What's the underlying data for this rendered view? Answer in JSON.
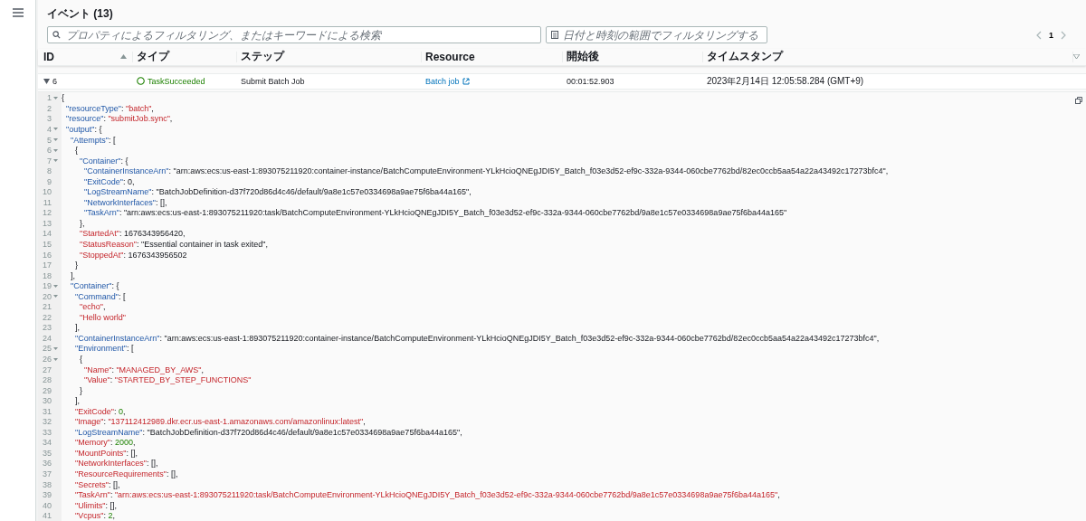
{
  "header": {
    "title": "イベント (13)"
  },
  "search": {
    "placeholder": "プロパティによるフィルタリング、またはキーワードによる検索"
  },
  "date_filter": {
    "placeholder": "日付と時刻の範囲でフィルタリングする"
  },
  "pagination": {
    "page": "1"
  },
  "table": {
    "columns": [
      {
        "label": "ID",
        "sorted": true
      },
      {
        "label": "タイプ",
        "sorted": false
      },
      {
        "label": "ステップ",
        "sorted": false
      },
      {
        "label": "Resource",
        "sorted": false
      },
      {
        "label": "開始後",
        "sorted": false
      },
      {
        "label": "タイムスタンプ",
        "sorted": false
      }
    ],
    "rows": [
      {
        "id": "6",
        "expanded": true,
        "type": "TaskSucceeded",
        "kind": "succeeded",
        "step": "Submit Batch Job",
        "resource": "Batch job",
        "elapsed": "00:01:52.903",
        "timestamp": "2023年2月14日 12:05:58.284 (GMT+9)"
      }
    ]
  },
  "code": {
    "lines": [
      {
        "number": "1",
        "fold": true,
        "tokens": [
          {
            "text": "{",
            "kind": "plain"
          }
        ]
      },
      {
        "number": "2",
        "fold": false,
        "tokens": [
          {
            "text": "  \"resourceType\"",
            "kind": "key"
          },
          {
            "text": ": ",
            "kind": "plain"
          },
          {
            "text": "\"batch\"",
            "kind": "string"
          },
          {
            "text": ",",
            "kind": "plain"
          }
        ]
      },
      {
        "number": "3",
        "fold": false,
        "tokens": [
          {
            "text": "  \"resource\"",
            "kind": "key"
          },
          {
            "text": ": ",
            "kind": "plain"
          },
          {
            "text": "\"submitJob.sync\"",
            "kind": "string"
          },
          {
            "text": ",",
            "kind": "plain"
          }
        ]
      },
      {
        "number": "4",
        "fold": true,
        "tokens": [
          {
            "text": "  \"output\"",
            "kind": "key"
          },
          {
            "text": ": {",
            "kind": "plain"
          }
        ]
      },
      {
        "number": "5",
        "fold": true,
        "tokens": [
          {
            "text": "    \"Attempts\"",
            "kind": "key"
          },
          {
            "text": ": [",
            "kind": "plain"
          }
        ]
      },
      {
        "number": "6",
        "fold": true,
        "tokens": [
          {
            "text": "      {",
            "kind": "plain"
          }
        ]
      },
      {
        "number": "7",
        "fold": true,
        "tokens": [
          {
            "text": "        \"Container\"",
            "kind": "key"
          },
          {
            "text": ": {",
            "kind": "plain"
          }
        ]
      },
      {
        "number": "8",
        "fold": false,
        "tokens": [
          {
            "text": "          \"ContainerInstanceArn\"",
            "kind": "key"
          },
          {
            "text": ": \"arn:aws:ecs:us-east-1:893075211920:container-instance/BatchComputeEnvironment-YLkHcioQNEgJDI5Y_Batch_f03e3d52-ef9c-332a-9344-060cbe7762bd/82ec0ccb5aa54a22a43492c17273bfc4\",",
            "kind": "plain"
          }
        ]
      },
      {
        "number": "9",
        "fold": false,
        "tokens": [
          {
            "text": "          \"ExitCode\"",
            "kind": "key"
          },
          {
            "text": ": 0,",
            "kind": "plain"
          }
        ]
      },
      {
        "number": "10",
        "fold": false,
        "tokens": [
          {
            "text": "          \"LogStreamName\"",
            "kind": "key"
          },
          {
            "text": ": \"BatchJobDefinition-d37f720d86d4c46/default/9a8e1c57e0334698a9ae75f6ba44a165\",",
            "kind": "plain"
          }
        ]
      },
      {
        "number": "11",
        "fold": false,
        "tokens": [
          {
            "text": "          \"NetworkInterfaces\"",
            "kind": "key"
          },
          {
            "text": ": [],",
            "kind": "plain"
          }
        ]
      },
      {
        "number": "12",
        "fold": false,
        "tokens": [
          {
            "text": "          \"TaskArn\"",
            "kind": "key"
          },
          {
            "text": ": \"arn:aws:ecs:us-east-1:893075211920:task/BatchComputeEnvironment-YLkHcioQNEgJDI5Y_Batch_f03e3d52-ef9c-332a-9344-060cbe7762bd/9a8e1c57e0334698a9ae75f6ba44a165\"",
            "kind": "plain"
          }
        ]
      },
      {
        "number": "13",
        "fold": false,
        "tokens": [
          {
            "text": "        },",
            "kind": "plain"
          }
        ]
      },
      {
        "number": "14",
        "fold": false,
        "tokens": [
          {
            "text": "        \"StartedAt\"",
            "kind": "string"
          },
          {
            "text": ": 1676343956420,",
            "kind": "plain"
          }
        ]
      },
      {
        "number": "15",
        "fold": false,
        "tokens": [
          {
            "text": "        \"StatusReason\"",
            "kind": "string"
          },
          {
            "text": ": \"Essential container in task exited\",",
            "kind": "plain"
          }
        ]
      },
      {
        "number": "16",
        "fold": false,
        "tokens": [
          {
            "text": "        \"StoppedAt\"",
            "kind": "string"
          },
          {
            "text": ": 1676343956502",
            "kind": "plain"
          }
        ]
      },
      {
        "number": "17",
        "fold": false,
        "tokens": [
          {
            "text": "      }",
            "kind": "plain"
          }
        ]
      },
      {
        "number": "18",
        "fold": false,
        "tokens": [
          {
            "text": "    ],",
            "kind": "plain"
          }
        ]
      },
      {
        "number": "19",
        "fold": true,
        "tokens": [
          {
            "text": "    \"Container\"",
            "kind": "key"
          },
          {
            "text": ": {",
            "kind": "plain"
          }
        ]
      },
      {
        "number": "20",
        "fold": true,
        "tokens": [
          {
            "text": "      \"Command\"",
            "kind": "key"
          },
          {
            "text": ": [",
            "kind": "plain"
          }
        ]
      },
      {
        "number": "21",
        "fold": false,
        "tokens": [
          {
            "text": "        \"echo\"",
            "kind": "string"
          },
          {
            "text": ",",
            "kind": "plain"
          }
        ]
      },
      {
        "number": "22",
        "fold": false,
        "tokens": [
          {
            "text": "        \"Hello world\"",
            "kind": "string"
          }
        ]
      },
      {
        "number": "23",
        "fold": false,
        "tokens": [
          {
            "text": "      ],",
            "kind": "plain"
          }
        ]
      },
      {
        "number": "24",
        "fold": false,
        "tokens": [
          {
            "text": "      \"ContainerInstanceArn\"",
            "kind": "key"
          },
          {
            "text": ": \"arn:aws:ecs:us-east-1:893075211920:container-instance/BatchComputeEnvironment-YLkHcioQNEgJDI5Y_Batch_f03e3d52-ef9c-332a-9344-060cbe7762bd/82ec0ccb5aa54a22a43492c17273bfc4\",",
            "kind": "plain"
          }
        ]
      },
      {
        "number": "25",
        "fold": true,
        "tokens": [
          {
            "text": "      \"Environment\"",
            "kind": "key"
          },
          {
            "text": ": [",
            "kind": "plain"
          }
        ]
      },
      {
        "number": "26",
        "fold": true,
        "tokens": [
          {
            "text": "        {",
            "kind": "plain"
          }
        ]
      },
      {
        "number": "27",
        "fold": false,
        "tokens": [
          {
            "text": "          \"Name\"",
            "kind": "string"
          },
          {
            "text": ": ",
            "kind": "plain"
          },
          {
            "text": "\"MANAGED_BY_AWS\"",
            "kind": "string"
          },
          {
            "text": ",",
            "kind": "plain"
          }
        ]
      },
      {
        "number": "28",
        "fold": false,
        "tokens": [
          {
            "text": "          \"Value\"",
            "kind": "string"
          },
          {
            "text": ": ",
            "kind": "plain"
          },
          {
            "text": "\"STARTED_BY_STEP_FUNCTIONS\"",
            "kind": "string"
          }
        ]
      },
      {
        "number": "29",
        "fold": false,
        "tokens": [
          {
            "text": "        }",
            "kind": "plain"
          }
        ]
      },
      {
        "number": "30",
        "fold": false,
        "tokens": [
          {
            "text": "      ],",
            "kind": "plain"
          }
        ]
      },
      {
        "number": "31",
        "fold": false,
        "tokens": [
          {
            "text": "      \"ExitCode\"",
            "kind": "string"
          },
          {
            "text": ": ",
            "kind": "plain"
          },
          {
            "text": "0",
            "kind": "number"
          },
          {
            "text": ",",
            "kind": "plain"
          }
        ]
      },
      {
        "number": "32",
        "fold": false,
        "tokens": [
          {
            "text": "      \"Image\"",
            "kind": "string"
          },
          {
            "text": ": ",
            "kind": "plain"
          },
          {
            "text": "\"137112412989.dkr.ecr.us-east-1.amazonaws.com/amazonlinux:latest\"",
            "kind": "string"
          },
          {
            "text": ",",
            "kind": "plain"
          }
        ]
      },
      {
        "number": "33",
        "fold": false,
        "tokens": [
          {
            "text": "      \"LogStreamName\"",
            "kind": "key"
          },
          {
            "text": ": \"BatchJobDefinition-d37f720d86d4c46/default/9a8e1c57e0334698a9ae75f6ba44a165\",",
            "kind": "plain"
          }
        ]
      },
      {
        "number": "34",
        "fold": false,
        "tokens": [
          {
            "text": "      \"Memory\"",
            "kind": "string"
          },
          {
            "text": ": ",
            "kind": "plain"
          },
          {
            "text": "2000",
            "kind": "number"
          },
          {
            "text": ",",
            "kind": "plain"
          }
        ]
      },
      {
        "number": "35",
        "fold": false,
        "tokens": [
          {
            "text": "      \"MountPoints\"",
            "kind": "string"
          },
          {
            "text": ": [],",
            "kind": "plain"
          }
        ]
      },
      {
        "number": "36",
        "fold": false,
        "tokens": [
          {
            "text": "      \"NetworkInterfaces\"",
            "kind": "string"
          },
          {
            "text": ": [],",
            "kind": "plain"
          }
        ]
      },
      {
        "number": "37",
        "fold": false,
        "tokens": [
          {
            "text": "      \"ResourceRequirements\"",
            "kind": "string"
          },
          {
            "text": ": [],",
            "kind": "plain"
          }
        ]
      },
      {
        "number": "38",
        "fold": false,
        "tokens": [
          {
            "text": "      \"Secrets\"",
            "kind": "string"
          },
          {
            "text": ": [],",
            "kind": "plain"
          }
        ]
      },
      {
        "number": "39",
        "fold": false,
        "tokens": [
          {
            "text": "      \"TaskArn\"",
            "kind": "string"
          },
          {
            "text": ": ",
            "kind": "plain"
          },
          {
            "text": "\"arn:aws:ecs:us-east-1:893075211920:task/BatchComputeEnvironment-YLkHcioQNEgJDI5Y_Batch_f03e3d52-ef9c-332a-9344-060cbe7762bd/9a8e1c57e0334698a9ae75f6ba44a165\"",
            "kind": "string"
          },
          {
            "text": ",",
            "kind": "plain"
          }
        ]
      },
      {
        "number": "40",
        "fold": false,
        "tokens": [
          {
            "text": "      \"Ulimits\"",
            "kind": "string"
          },
          {
            "text": ": [],",
            "kind": "plain"
          }
        ]
      },
      {
        "number": "41",
        "fold": false,
        "tokens": [
          {
            "text": "      \"Vcpus\"",
            "kind": "string"
          },
          {
            "text": ": ",
            "kind": "plain"
          },
          {
            "text": "2",
            "kind": "number"
          },
          {
            "text": ",",
            "kind": "plain"
          }
        ]
      }
    ]
  }
}
